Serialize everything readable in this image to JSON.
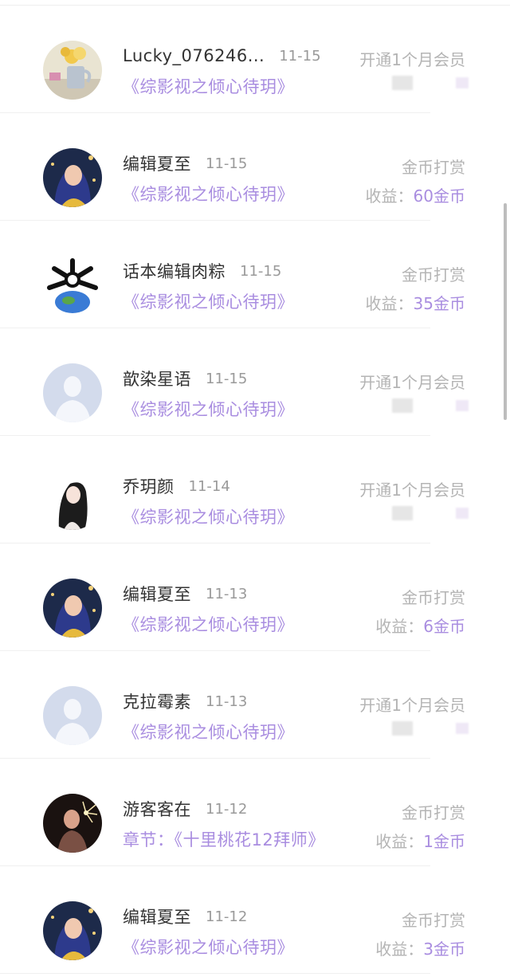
{
  "colors": {
    "accent_purple": "#a98de0",
    "name_text": "#333333",
    "muted_text": "#b4b4b4",
    "date_text": "#9a9a9a"
  },
  "rows": [
    {
      "avatar": "flower-vase-avatar",
      "name": "Lucky_076246...",
      "date": "11-15",
      "book": "《综影视之倾心待玥》",
      "type": "开通1个月会员",
      "income_label": "",
      "income_value": ""
    },
    {
      "avatar": "woman-blue-hair-avatar",
      "name": "编辑夏至",
      "date": "11-15",
      "book": "《综影视之倾心待玥》",
      "type": "金币打赏",
      "income_label": "收益：",
      "income_value": "60金币"
    },
    {
      "avatar": "cartoon-planet-avatar",
      "name": "话本编辑肉粽",
      "date": "11-15",
      "book": "《综影视之倾心待玥》",
      "type": "金币打赏",
      "income_label": "收益：",
      "income_value": "35金币"
    },
    {
      "avatar": "default-user-avatar",
      "name": "歆染星语",
      "date": "11-15",
      "book": "《综影视之倾心待玥》",
      "type": "开通1个月会员",
      "income_label": "",
      "income_value": ""
    },
    {
      "avatar": "anime-girl-avatar",
      "name": "乔玥颜",
      "date": "11-14",
      "book": "《综影视之倾心待玥》",
      "type": "开通1个月会员",
      "income_label": "",
      "income_value": ""
    },
    {
      "avatar": "woman-blue-hair-avatar",
      "name": "编辑夏至",
      "date": "11-13",
      "book": "《综影视之倾心待玥》",
      "type": "金币打赏",
      "income_label": "收益：",
      "income_value": "6金币"
    },
    {
      "avatar": "default-user-avatar",
      "name": "克拉霉素",
      "date": "11-13",
      "book": "《综影视之倾心待玥》",
      "type": "开通1个月会员",
      "income_label": "",
      "income_value": ""
    },
    {
      "avatar": "sparkler-person-avatar",
      "name": "游客客在",
      "date": "11-12",
      "book": "章节：《十里桃花12拜师》",
      "type": "金币打赏",
      "income_label": "收益：",
      "income_value": "1金币"
    },
    {
      "avatar": "woman-blue-hair-avatar",
      "name": "编辑夏至",
      "date": "11-12",
      "book": "《综影视之倾心待玥》",
      "type": "金币打赏",
      "income_label": "收益：",
      "income_value": "3金币"
    }
  ]
}
